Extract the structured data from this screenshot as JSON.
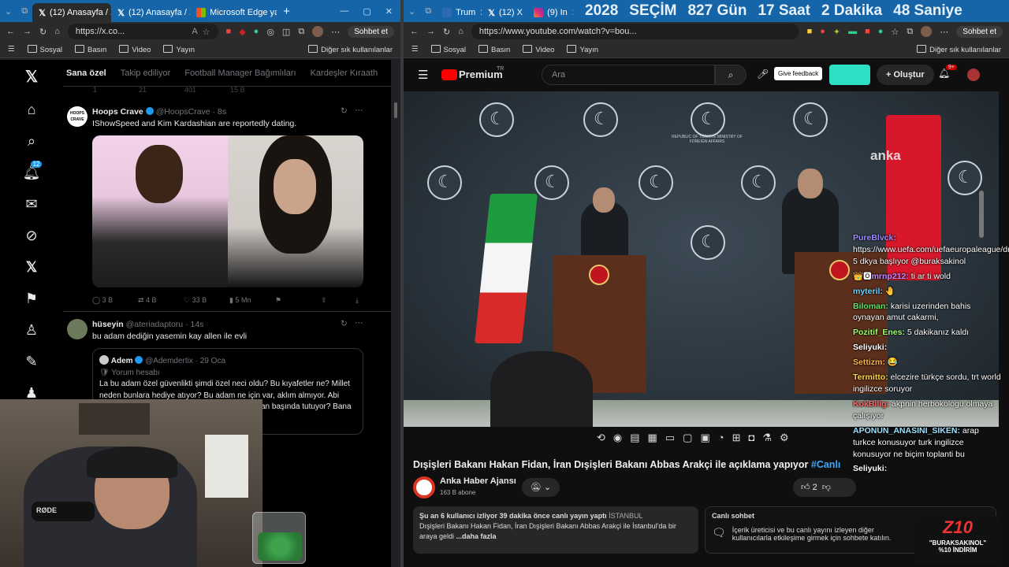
{
  "left": {
    "tabs": [
      "(12) Anasayfa / X",
      "(12) Anasayfa / X",
      "Microsoft Edge yar"
    ],
    "url": "https://x.co...",
    "sync_label": "Sohbet et",
    "favorites": [
      "Sosyal",
      "Basın",
      "Video",
      "Yayın"
    ],
    "favorites_more": "Diğer sık kullanılanlar",
    "sidebar_badge": "12",
    "feed_tabs": [
      "Sana özel",
      "Takip ediliyor",
      "Football Manager Bağımlıları",
      "Kardeşler Kıraath"
    ],
    "partial_stats": [
      "1",
      "21",
      "401",
      "15 B"
    ],
    "post1": {
      "avatar_text": "HOOPS CRAVE",
      "name": "Hoops Crave",
      "handle": "@HoopsCrave",
      "time": "· 8s",
      "text": "IShowSpeed and Kim Kardashian are reportedly dating.",
      "stats": [
        "3 B",
        "4 B",
        "33 B",
        "5 Mn"
      ]
    },
    "post2": {
      "name": "hüseyin",
      "handle": "@ateriadaptoru",
      "time": "· 14s",
      "text": "bu adam dediğin yasemin kay allen ile evli",
      "quote": {
        "name": "Adem",
        "handle": "@Ademdertix",
        "time": "· 29 Oca",
        "tag": "Yorum hesabı",
        "text1": "La bu adam özel güvenlikti şimdi özel neci oldu? Bu kıyafetler ne? Millet",
        "text2": "neden bunlara hediye atıyor? Bu adam ne için var, aklım almıyor. Abi",
        "text3": "an başında tutuyor? Bana"
      }
    }
  },
  "right": {
    "tabs": [
      "Trum",
      "(12) X",
      "(9) In"
    ],
    "countdown": [
      "2028",
      "SEÇİM",
      "827 Gün",
      "17 Saat",
      "2 Dakika",
      "48 Saniye"
    ],
    "url": "https://www.youtube.com/watch?v=bou...",
    "sync_label": "Sohbet et",
    "favorites": [
      "Sosyal",
      "Basın",
      "Video",
      "Yayın"
    ],
    "favorites_more": "Diğer sık kullanılanlar",
    "yt": {
      "logo": "Premium",
      "logo_sup": "TR",
      "search_placeholder": "Ara",
      "feedback": "Give feedback",
      "create": "Oluştur",
      "notif_badge": "9+",
      "title": "Dışişleri Bakanı Hakan Fidan, İran Dışişleri Bakanı Abbas Arakçi ile açıklama yapıyor",
      "title_tag": "#Canlı",
      "channel": "Anka Haber Ajansı",
      "subs": "163 B abone",
      "likes": "2",
      "desc_meta": "Şu an 6 kullanıcı izliyor  39 dakika önce canlı yayın yaptı",
      "desc_loc": "İSTANBUL",
      "desc_text": "Dışişleri Bakanı Hakan Fidan, İran Dışişleri Bakanı Abbas Arakçi ile İstanbul'da bir araya geldi",
      "desc_more": "...daha fazla",
      "chat_title": "Canlı sohbet",
      "chat_text": "İçerik üreticisi ve bu canlı yayını izleyen diğer kullanıcılarla etkileşime girmek için sohbete katılın.",
      "watermark": "anka",
      "seal_caption": "REPUBLIC OF TÜRKİYE MINISTRY OF FOREIGN AFFAIRS",
      "promo_line1": "\"BURAKSAKINOL\"",
      "promo_line2": "%10 İNDİRİM"
    },
    "chat": [
      {
        "user": "PureBlvck:",
        "msg": "https://www.uefa.com/uefaeuropaleague/draws/ 5 dkya başlıyor @buraksakinol"
      },
      {
        "user": "mrnp212:",
        "msg": "ti ar ti wold"
      },
      {
        "user": "myteril:",
        "msg": "🤚"
      },
      {
        "user": "Biloman:",
        "msg": "karisi uzerinden bahis oynayan amut cakarmi,"
      },
      {
        "user": "Pozitif_Enes:",
        "msg": "5 dakikanız kaldı"
      },
      {
        "user": "Seliyuki:",
        "msg": ""
      },
      {
        "user": "Settizm:",
        "msg": "😂"
      },
      {
        "user": "Termitto:",
        "msg": "elcezire türkçe sordu, trt world ingilizce soruyor"
      },
      {
        "user": "KokBilig:",
        "msg": "akpnin herbokologu olmaya çalışıyor"
      },
      {
        "user": "APONUN_ANASINI_SIKEN:",
        "msg": "arap turkce konusuyor turk ingilizce konusuyor ne biçim toplanti bu"
      },
      {
        "user": "Seliyuki:",
        "msg": ""
      }
    ]
  }
}
